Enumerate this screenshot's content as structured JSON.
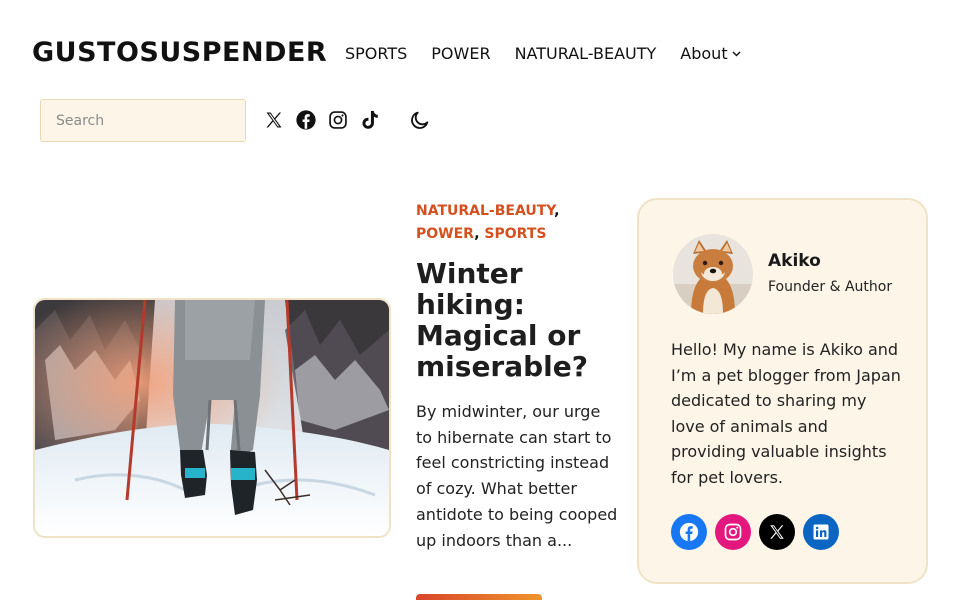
{
  "site": {
    "logo": "GUSTOSUSPENDER"
  },
  "nav": {
    "items": [
      "SPORTS",
      "POWER",
      "NATURAL-BEAUTY"
    ],
    "about": "About"
  },
  "search": {
    "placeholder": "Search"
  },
  "social_top": [
    "x-icon",
    "facebook-icon",
    "instagram-icon",
    "tiktok-icon"
  ],
  "theme_toggle": "moon-icon",
  "post": {
    "categories": [
      "NATURAL-BEAUTY",
      "POWER",
      "SPORTS"
    ],
    "title": "Winter hiking: Magical or miserable?",
    "excerpt": "By midwinter, our urge to hibernate can start to feel constricting instead of cozy. What better antidote to being cooped up indoors than a..."
  },
  "author": {
    "name": "Akiko",
    "role": "Founder & Author",
    "bio": "Hello! My name is Akiko and I’m a pet blogger from Japan dedicated to sharing my love of animals and providing valuable insights for pet lovers.",
    "social": [
      {
        "icon": "facebook-icon",
        "color": "#1877f2"
      },
      {
        "icon": "instagram-icon",
        "color": "#e4177e"
      },
      {
        "icon": "x-icon",
        "color": "#000000"
      },
      {
        "icon": "linkedin-icon",
        "color": "#0a66c2"
      }
    ]
  },
  "colors": {
    "accent": "#d4501f",
    "card_bg": "#fdf6e8",
    "card_border": "#f0e2c6",
    "search_bg": "#fdf6e8"
  }
}
